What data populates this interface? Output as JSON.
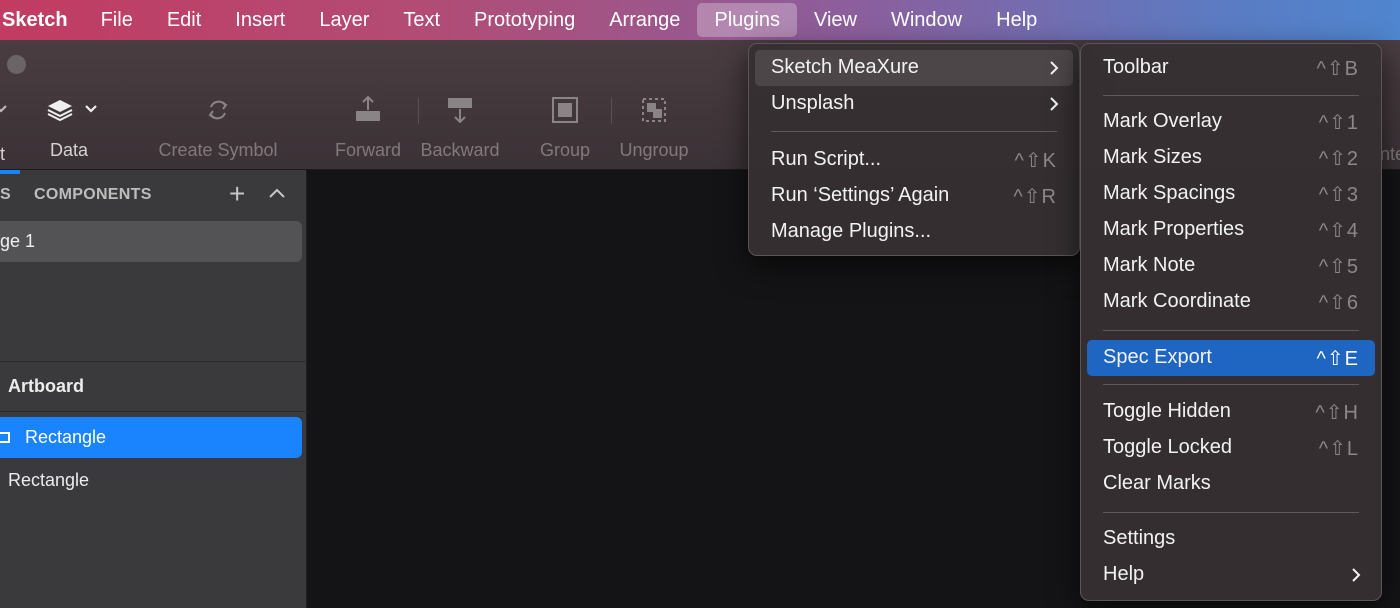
{
  "menubar": {
    "app_name": "Sketch",
    "items": [
      "File",
      "Edit",
      "Insert",
      "Layer",
      "Text",
      "Prototyping",
      "Arrange",
      "Plugins",
      "View",
      "Window",
      "Help"
    ],
    "active": "Plugins"
  },
  "toolbar": {
    "buttons": [
      {
        "label": "Data",
        "icon": "layers-icon"
      },
      {
        "label": "Create Symbol",
        "icon": "refresh-symbol-icon"
      },
      {
        "label": "Forward",
        "icon": "forward-icon"
      },
      {
        "label": "Backward",
        "icon": "backward-icon"
      },
      {
        "label": "Group",
        "icon": "group-icon"
      },
      {
        "label": "Ungroup",
        "icon": "ungroup-icon"
      }
    ],
    "partial_left_label": "t",
    "partial_right_label": "nte"
  },
  "sidebar": {
    "pages_tab_partial": "S",
    "components_tab": "COMPONENTS",
    "page_item": "ge 1",
    "artboard": "Artboard",
    "layers": [
      "Rectangle",
      "Rectangle"
    ]
  },
  "plugins_menu": {
    "items": [
      {
        "label": "Sketch MeaXure",
        "shortcut": "",
        "submenu": true
      },
      {
        "label": "Unsplash",
        "shortcut": "",
        "submenu": true
      },
      {
        "label": "Run Script...",
        "shortcut": "^⇧K",
        "submenu": false
      },
      {
        "label": "Run ‘Settings’ Again",
        "shortcut": "^⇧R",
        "submenu": false
      },
      {
        "label": "Manage Plugins...",
        "shortcut": "",
        "submenu": false
      }
    ]
  },
  "meaxure_menu": {
    "items": [
      {
        "label": "Toolbar",
        "shortcut": "^⇧B"
      },
      {
        "label": "Mark Overlay",
        "shortcut": "^⇧1"
      },
      {
        "label": "Mark Sizes",
        "shortcut": "^⇧2"
      },
      {
        "label": "Mark Spacings",
        "shortcut": "^⇧3"
      },
      {
        "label": "Mark Properties",
        "shortcut": "^⇧4"
      },
      {
        "label": "Mark Note",
        "shortcut": "^⇧5"
      },
      {
        "label": "Mark Coordinate",
        "shortcut": "^⇧6"
      },
      {
        "label": "Spec Export",
        "shortcut": "^⇧E"
      },
      {
        "label": "Toggle Hidden",
        "shortcut": "^⇧H"
      },
      {
        "label": "Toggle Locked",
        "shortcut": "^⇧L"
      },
      {
        "label": "Clear Marks",
        "shortcut": ""
      },
      {
        "label": "Settings",
        "shortcut": ""
      },
      {
        "label": "Help",
        "shortcut": ""
      }
    ],
    "highlighted": "Spec Export"
  },
  "colors": {
    "accent_blue": "#1a84ff",
    "menu_highlight": "#1f65c2"
  }
}
